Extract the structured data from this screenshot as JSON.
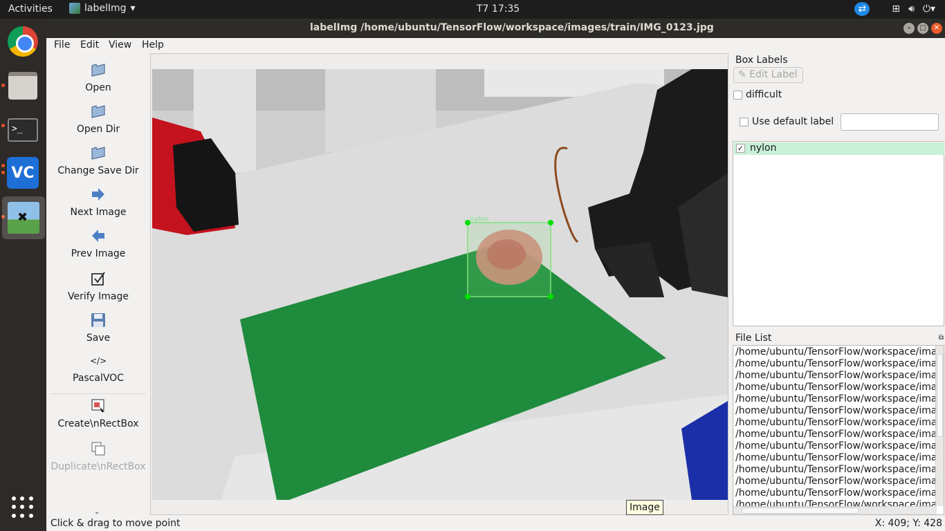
{
  "topbar": {
    "activities": "Activities",
    "app_name": "labelImg",
    "clock": "T7 17:35"
  },
  "dock": {
    "items": [
      "chrome-icon",
      "files-icon",
      "terminal-icon",
      "vnc-icon",
      "labelimg-icon",
      "show-apps-icon"
    ]
  },
  "window": {
    "title": "labelImg /home/ubuntu/TensorFlow/workspace/images/train/IMG_0123.jpg"
  },
  "menu": {
    "file": "File",
    "edit": "Edit",
    "view": "View",
    "help": "Help"
  },
  "toolbar": {
    "open": "Open",
    "open_dir": "Open Dir",
    "change_save_dir": "Change Save Dir",
    "next_image": "Next Image",
    "prev_image": "Prev Image",
    "verify_image": "Verify Image",
    "save": "Save",
    "format": "PascalVOC",
    "create_rect": "Create\\nRectBox",
    "duplicate_rect": "Duplicate\\nRectBox"
  },
  "canvas": {
    "tooltip": "Image",
    "box_label": "nylon"
  },
  "box_labels": {
    "title": "Box Labels",
    "edit_label": "Edit Label",
    "difficult": "difficult",
    "use_default_label": "Use default label",
    "default_label_value": "",
    "labels": [
      {
        "name": "nylon",
        "checked": true
      }
    ]
  },
  "file_list": {
    "title": "File List",
    "items": [
      "/home/ubuntu/TensorFlow/workspace/ima",
      "/home/ubuntu/TensorFlow/workspace/ima",
      "/home/ubuntu/TensorFlow/workspace/ima",
      "/home/ubuntu/TensorFlow/workspace/ima",
      "/home/ubuntu/TensorFlow/workspace/ima",
      "/home/ubuntu/TensorFlow/workspace/ima",
      "/home/ubuntu/TensorFlow/workspace/ima",
      "/home/ubuntu/TensorFlow/workspace/ima",
      "/home/ubuntu/TensorFlow/workspace/ima",
      "/home/ubuntu/TensorFlow/workspace/ima",
      "/home/ubuntu/TensorFlow/workspace/ima",
      "/home/ubuntu/TensorFlow/workspace/ima",
      "/home/ubuntu/TensorFlow/workspace/ima",
      "/home/ubuntu/TensorFlow/workspace/ima"
    ]
  },
  "status": {
    "message": "Click & drag to move point",
    "coords": "X: 409; Y: 428"
  },
  "colors": {
    "selected_label_bg": "#c7f0d6",
    "box_stroke": "#7fe07f",
    "box_handle": "#00e000"
  }
}
